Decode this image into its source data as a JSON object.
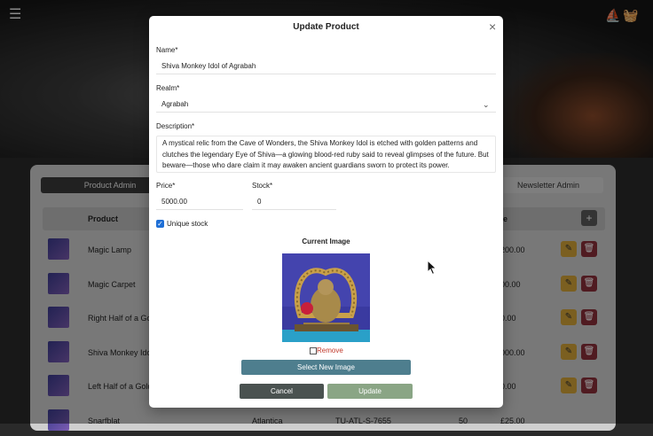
{
  "background": {
    "admin_tabs": {
      "product": "Product Admin",
      "newsletter": "Newsletter Admin"
    },
    "table_headers": {
      "product": "Product",
      "price": "ce"
    },
    "rows": [
      {
        "name": "Magic Lamp",
        "price": "200.00"
      },
      {
        "name": "Magic Carpet",
        "price": "00.00"
      },
      {
        "name": "Right Half of a Golde",
        "price": "0.00"
      },
      {
        "name": "Shiva Monkey Idol o",
        "price": "000.00"
      },
      {
        "name": "Left Half of a Golde",
        "price": "0.00"
      },
      {
        "name": "Snarfblat",
        "region": "Atlantica",
        "sku": "TU-ATL-S-7655",
        "stock": "50",
        "price": "£25.00"
      }
    ]
  },
  "modal": {
    "title": "Update Product",
    "name_label": "Name*",
    "name_value": "Shiva Monkey Idol of Agrabah",
    "realm_label": "Realm*",
    "realm_value": "Agrabah",
    "description_label": "Description*",
    "description_value": "A mystical relic from the Cave of Wonders, the Shiva Monkey Idol is etched with golden patterns and clutches the legendary Eye of Shiva—a glowing blood-red ruby said to reveal glimpses of the future. But beware—those who dare claim it may awaken ancient guardians sworn to protect its power.",
    "price_label": "Price*",
    "price_value": "5000.00",
    "stock_label": "Stock*",
    "stock_value": "0",
    "unique_stock_label": "Unique stock",
    "current_image_label": "Current Image",
    "remove_label": "Remove",
    "select_image_label": "Select New Image",
    "cancel_label": "Cancel",
    "update_label": "Update"
  },
  "colors": {
    "select_button": "#4e7e8e",
    "cancel_button": "#4a5250",
    "update_button": "#8aa585",
    "edit_button": "#d4a437",
    "delete_button": "#8a2f3a",
    "checkbox": "#1f6fd6",
    "remove_text": "#c0392b"
  },
  "icons": [
    "hamburger-icon",
    "ship-icon",
    "basket-icon",
    "close-icon",
    "chevron-down-icon",
    "edit-icon",
    "trash-icon",
    "plus-icon",
    "pointer-cursor-icon"
  ]
}
